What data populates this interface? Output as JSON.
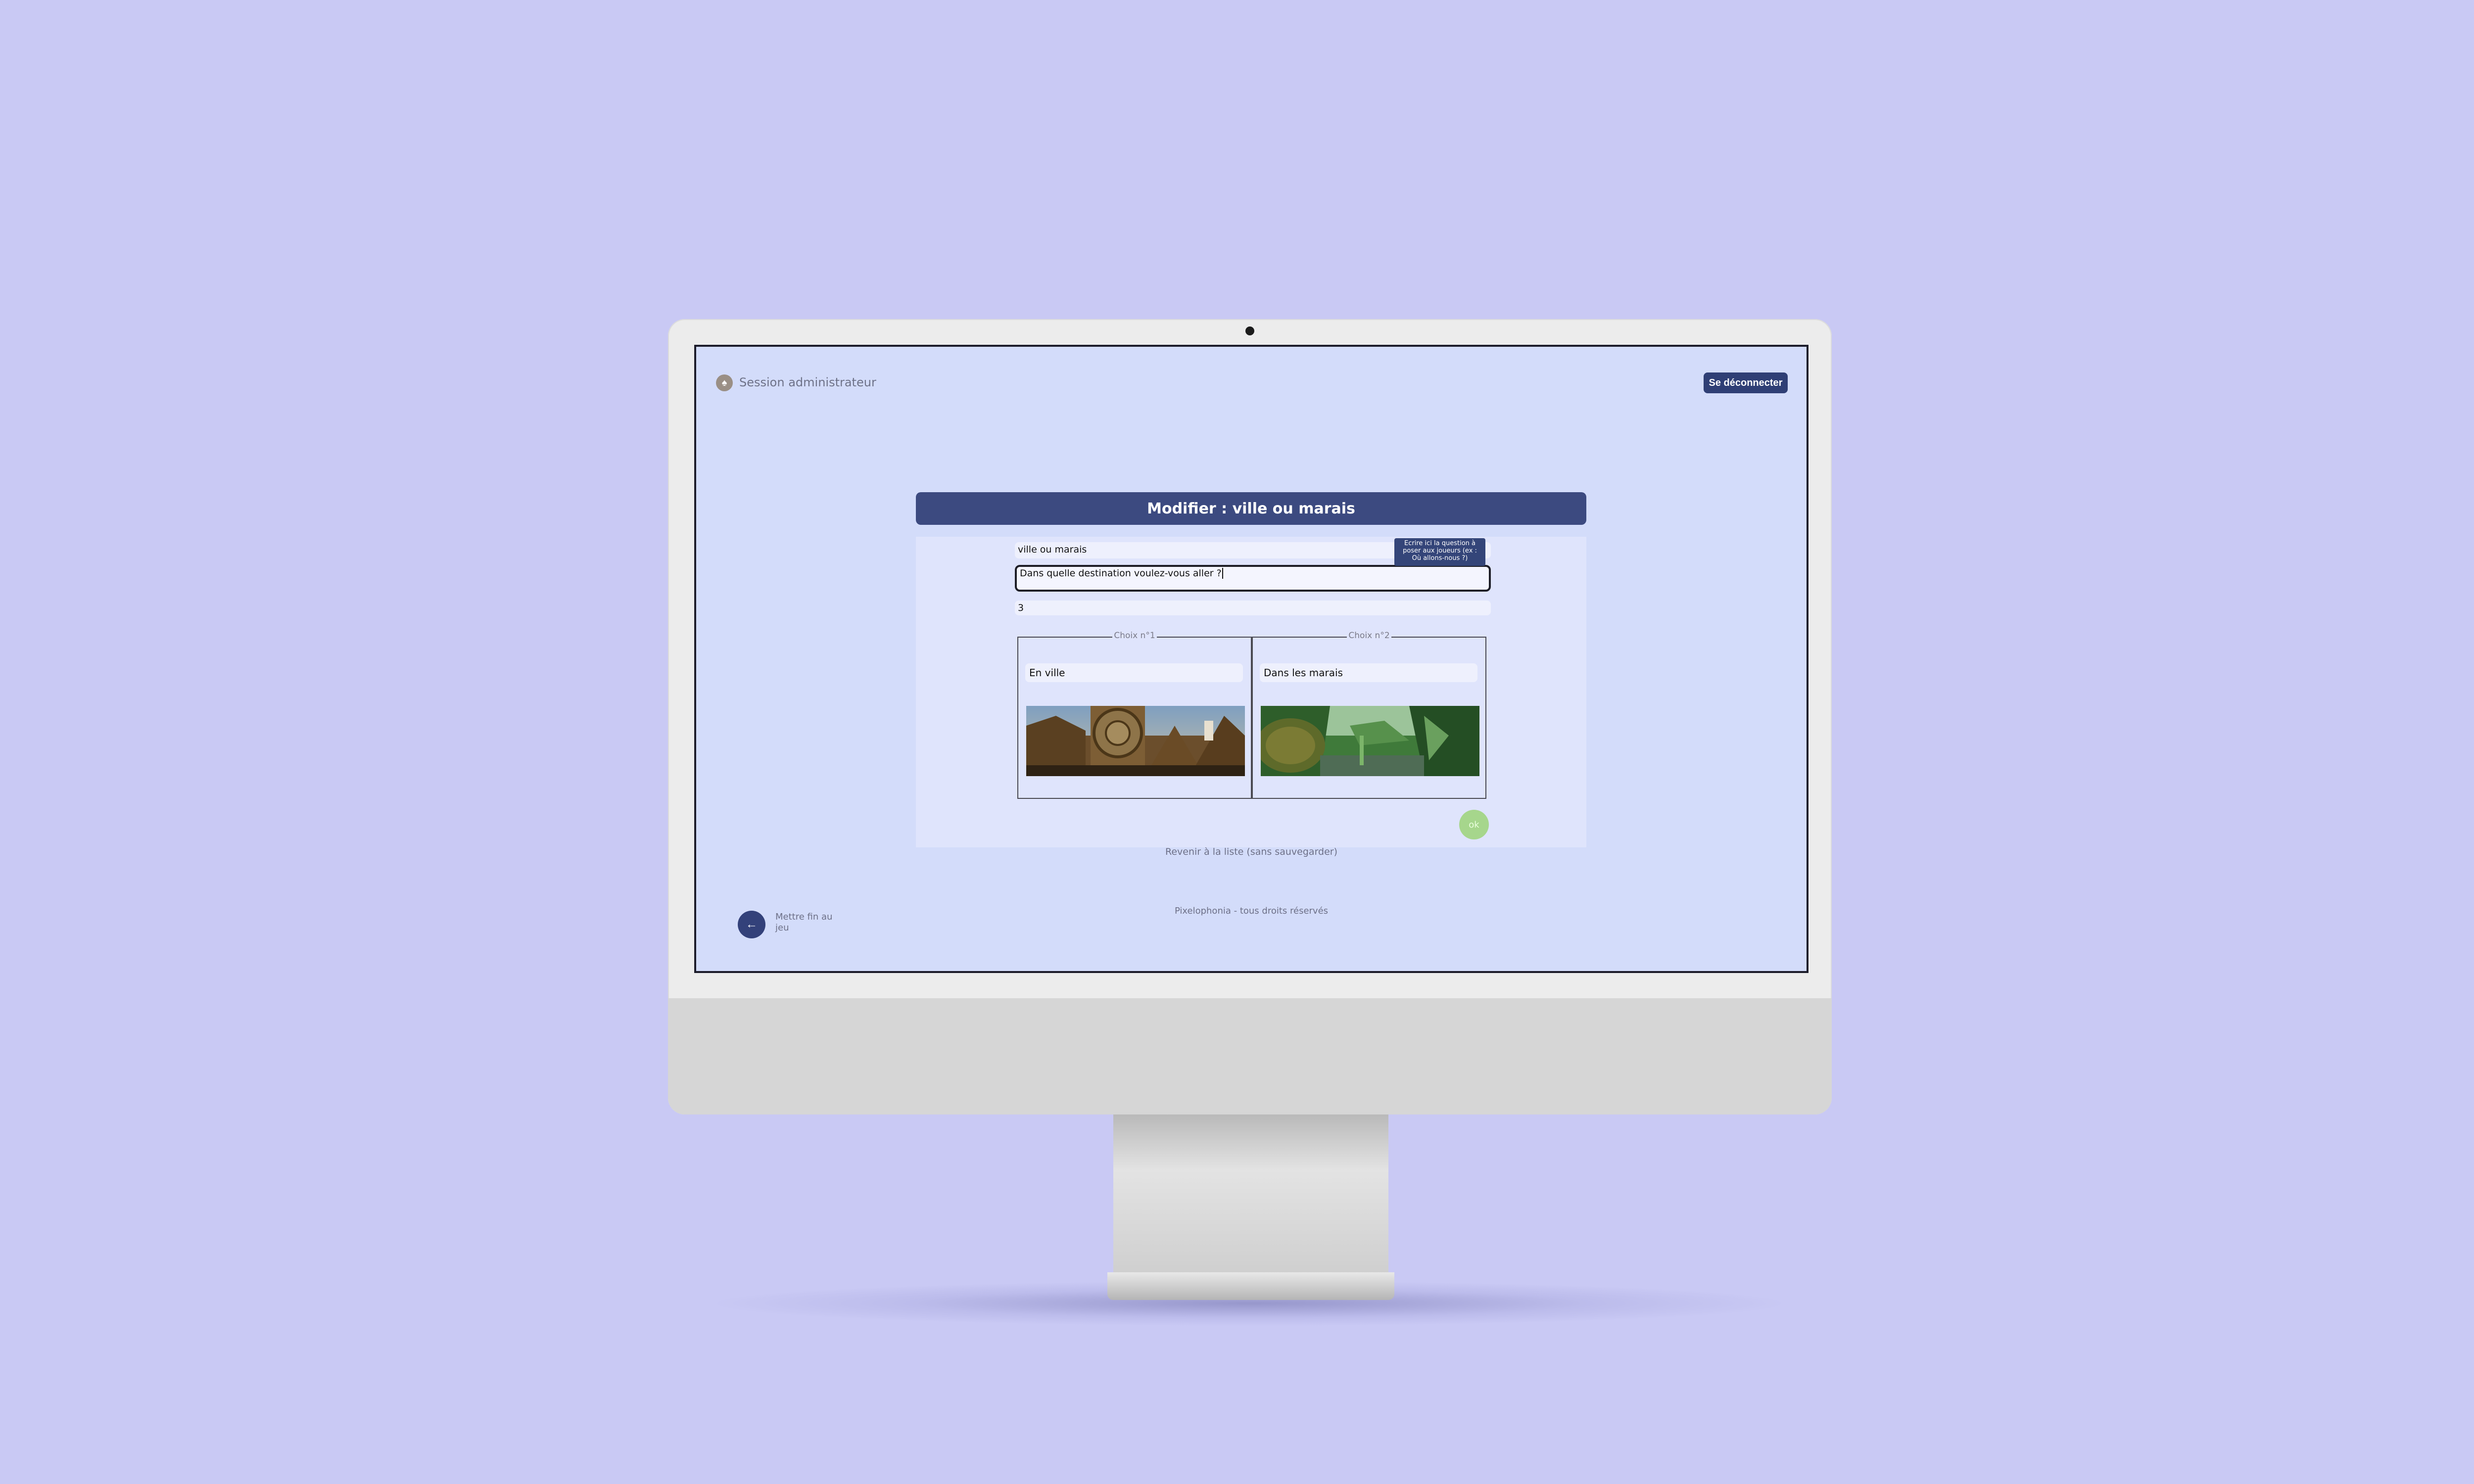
{
  "header": {
    "session_label": "Session administrateur",
    "logout_label": "Se déconnecter"
  },
  "form": {
    "title": "Modifier : ville ou marais",
    "name_value": "ville ou marais",
    "question_value": "Dans quelle destination voulez-vous aller ?",
    "number_value": "3",
    "tooltip_lines": [
      "Ecrire ici la question à",
      "poser aux joueurs (ex :",
      "Où allons-nous ?)"
    ],
    "choices": [
      {
        "legend": "Choix n°1",
        "value": "En ville",
        "image": "town-scene-image"
      },
      {
        "legend": "Choix n°2",
        "value": "Dans les marais",
        "image": "swamp-scene-image"
      }
    ],
    "ok_label": "ok",
    "back_link": "Revenir à la liste (sans sauvegarder)"
  },
  "footer": {
    "copyright": "Pixelophonia - tous droits réservés",
    "end_game_label": "Mettre fin au jeu",
    "end_game_icon": "arrow-left-icon"
  },
  "colors": {
    "background": "#c9c9f4",
    "screen": "#d3dcfa",
    "primary": "#3c4a80",
    "ok_button": "#a6d68c"
  }
}
